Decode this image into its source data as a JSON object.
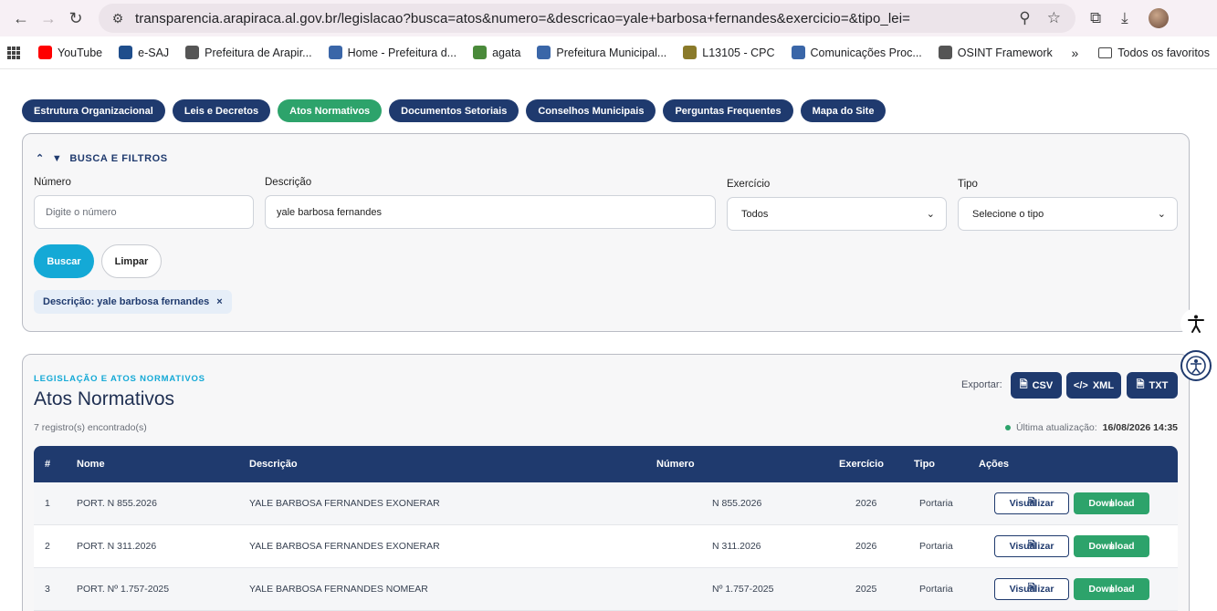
{
  "browser": {
    "url": "transparencia.arapiraca.al.gov.br/legislacao?busca=atos&numero=&descricao=yale+barbosa+fernandes&exercicio=&tipo_lei=",
    "bookmarks": [
      {
        "label": "YouTube",
        "color": "#ff0000"
      },
      {
        "label": "e-SAJ",
        "color": "#1f4e8c"
      },
      {
        "label": "Prefeitura de Arapir...",
        "color": "#555555"
      },
      {
        "label": "Home - Prefeitura d...",
        "color": "#3a66a8"
      },
      {
        "label": "agata",
        "color": "#4a8a3a"
      },
      {
        "label": "Prefeitura Municipal...",
        "color": "#3a66a8"
      },
      {
        "label": "L13105 - CPC",
        "color": "#8a7a2a"
      },
      {
        "label": "Comunicações Proc...",
        "color": "#3a66a8"
      },
      {
        "label": "OSINT Framework",
        "color": "#555555"
      }
    ],
    "overflow": "»",
    "folder": "Todos os favoritos"
  },
  "nav_pills": [
    {
      "label": "Estrutura Organizacional",
      "active": false
    },
    {
      "label": "Leis e Decretos",
      "active": false
    },
    {
      "label": "Atos Normativos",
      "active": true
    },
    {
      "label": "Documentos Setoriais",
      "active": false
    },
    {
      "label": "Conselhos Municipais",
      "active": false
    },
    {
      "label": "Perguntas Frequentes",
      "active": false
    },
    {
      "label": "Mapa do Site",
      "active": false
    }
  ],
  "filters": {
    "heading": "BUSCA E FILTROS",
    "numero_label": "Número",
    "numero_placeholder": "Digite o número",
    "descricao_label": "Descrição",
    "descricao_value": "yale barbosa fernandes",
    "exercicio_label": "Exercício",
    "exercicio_value": "Todos",
    "tipo_label": "Tipo",
    "tipo_value": "Selecione o tipo",
    "buscar": "Buscar",
    "limpar": "Limpar",
    "chip": "Descrição: yale barbosa fernandes",
    "chip_close": "×"
  },
  "results": {
    "kicker": "LEGISLAÇÃO E ATOS NORMATIVOS",
    "title": "Atos Normativos",
    "count": "7 registro(s) encontrado(s)",
    "export_label": "Exportar:",
    "export": [
      "CSV",
      "XML",
      "TXT"
    ],
    "updated_label": "Última atualização:",
    "updated_value": "16/08/2026 14:35",
    "columns": [
      "#",
      "Nome",
      "Descrição",
      "Número",
      "Exercício",
      "Tipo",
      "Ações"
    ],
    "rows": [
      {
        "n": "1",
        "nome": "PORT. N 855.2026",
        "descricao": "YALE BARBOSA FERNANDES EXONERAR",
        "numero": "N 855.2026",
        "exercicio": "2026",
        "tipo": "Portaria"
      },
      {
        "n": "2",
        "nome": "PORT. N 311.2026",
        "descricao": "YALE BARBOSA FERNANDES EXONERAR",
        "numero": "N 311.2026",
        "exercicio": "2026",
        "tipo": "Portaria"
      },
      {
        "n": "3",
        "nome": "PORT. Nº 1.757-2025",
        "descricao": "YALE BARBOSA FERNANDES NOMEAR",
        "numero": "Nº 1.757-2025",
        "exercicio": "2025",
        "tipo": "Portaria"
      }
    ],
    "btn_visualizar": "Visualizar",
    "btn_download": "Download"
  }
}
